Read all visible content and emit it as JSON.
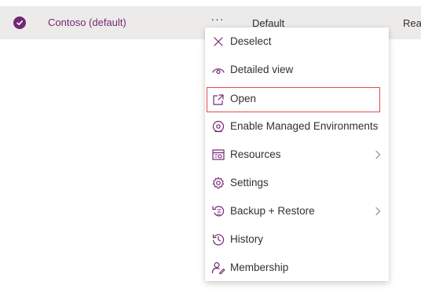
{
  "row": {
    "name": "Contoso (default)",
    "type": "Default",
    "state_partial": "Read",
    "more_label": "···"
  },
  "menu": {
    "items": [
      {
        "label": "Deselect",
        "icon": "close-icon"
      },
      {
        "label": "Detailed view",
        "icon": "eye-icon"
      },
      {
        "label": "Open",
        "icon": "open-external-icon",
        "focused": true
      },
      {
        "label": "Enable Managed Environments",
        "icon": "managed-environment-icon"
      },
      {
        "label": "Resources",
        "icon": "resources-icon",
        "submenu": true
      },
      {
        "label": "Settings",
        "icon": "gear-icon"
      },
      {
        "label": "Backup + Restore",
        "icon": "backup-restore-icon",
        "submenu": true
      },
      {
        "label": "History",
        "icon": "history-icon"
      },
      {
        "label": "Membership",
        "icon": "membership-icon"
      }
    ]
  },
  "colors": {
    "accent": "#742774",
    "row_selected_bg": "#edebe9",
    "focus_outline": "#e04b4b"
  }
}
